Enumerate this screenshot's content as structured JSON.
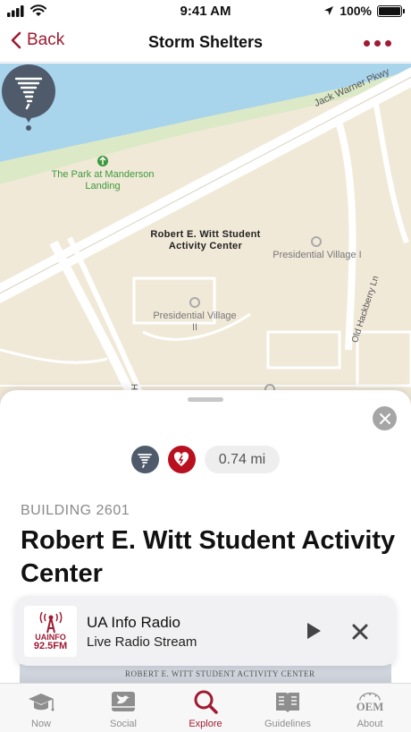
{
  "status_bar": {
    "time": "9:41 AM",
    "battery": "100%"
  },
  "nav": {
    "back_label": "Back",
    "title": "Storm Shelters"
  },
  "map": {
    "labels": {
      "park": "The Park at Manderson Landing",
      "building": "Robert E. Witt Student Activity Center",
      "presidential_village_1": "Presidential Village I",
      "presidential_village_2": "Presidential Village II",
      "jack_warner": "Jack Warner Pkwy",
      "old_hackberry": "Old Hackberry Ln",
      "partial_road": "H"
    },
    "colors": {
      "land": "#f1e9d8",
      "water": "#a8d4ec",
      "road": "#ffffff",
      "pin": "#4f5b6a"
    }
  },
  "sheet": {
    "distance": "0.74 mi",
    "building_number": "BUILDING 2601",
    "building_name": "Robert E. Witt Student Activity Center",
    "photo_caption": "ROBERT E. WITT STUDENT ACTIVITY CENTER"
  },
  "radio": {
    "title": "UA Info Radio",
    "subtitle": "Live Radio Stream",
    "logo_text": "UAINFO",
    "logo_freq": "92.5FM"
  },
  "tabs": [
    {
      "label": "Now",
      "icon": "graduation-cap-icon",
      "active": false
    },
    {
      "label": "Social",
      "icon": "social-icon",
      "active": false
    },
    {
      "label": "Explore",
      "icon": "magnifier-icon",
      "active": true
    },
    {
      "label": "Guidelines",
      "icon": "book-icon",
      "active": false
    },
    {
      "label": "About",
      "icon": "oem-logo-icon",
      "active": false
    }
  ],
  "colors": {
    "accent": "#9e1b32",
    "aed": "#b8101f",
    "tab_inactive": "#8e8e8e"
  }
}
